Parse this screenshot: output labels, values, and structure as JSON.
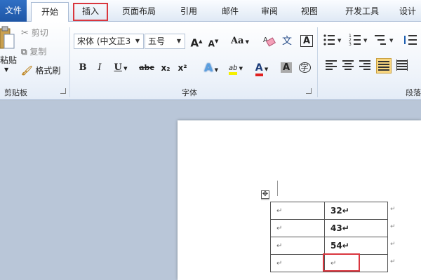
{
  "tabs": {
    "file": "文件",
    "home": "开始",
    "insert": "插入",
    "page_layout": "页面布局",
    "references": "引用",
    "mailings": "邮件",
    "review": "审阅",
    "view": "视图",
    "developer": "开发工具",
    "design": "设计"
  },
  "clipboard": {
    "paste": "粘贴",
    "cut": "剪切",
    "copy": "复制",
    "format_painter": "格式刷",
    "group_label": "剪贴板"
  },
  "font": {
    "font_name": "宋体 (中文正3",
    "font_size": "五号",
    "grow_label": "A",
    "shrink_label": "A",
    "case_label": "Aa",
    "bold": "B",
    "italic": "I",
    "underline": "U",
    "strike": "abc",
    "subscript": "x₂",
    "superscript": "x²",
    "highlight": "ab",
    "font_color": "A",
    "shade": "A",
    "phonetic": "文",
    "char_border": "A",
    "enclose": "字",
    "group_label": "字体"
  },
  "paragraph": {
    "group_label": "段落"
  },
  "document": {
    "table_rows": [
      {
        "c1": "↵",
        "c2": "32↵"
      },
      {
        "c1": "↵",
        "c2": "43↵"
      },
      {
        "c1": "↵",
        "c2": "54↵"
      },
      {
        "c1": "↵",
        "c2": "↵"
      }
    ],
    "row_mark": "↵",
    "move_handle": "✥"
  },
  "colors": {
    "accent_red": "#d9363e",
    "file_tab": "#1e56a6"
  }
}
